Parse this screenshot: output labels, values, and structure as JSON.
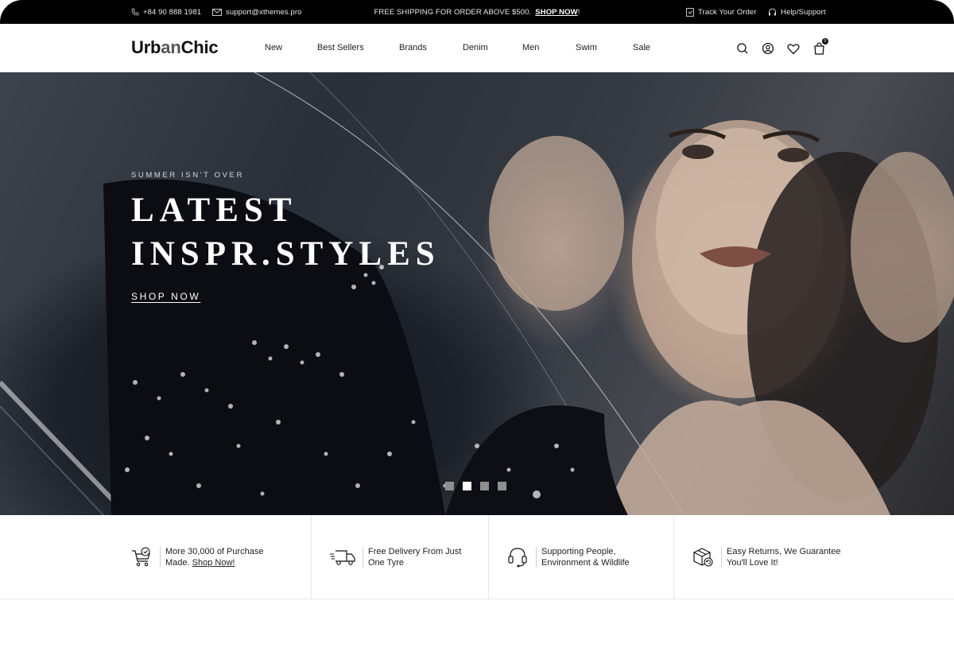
{
  "topbar": {
    "phone": "+84 90 888 1981",
    "email": "support@xthemes.pro",
    "promo_text": "FREE SHIPPING FOR ORDER ABOVE $500.",
    "promo_link": "SHOP NOW",
    "promo_suffix": "!",
    "track_order": "Track Your Order",
    "help": "Help/Support"
  },
  "header": {
    "logo_part1": "Urb",
    "logo_part2": "an",
    "logo_part3": "Chic",
    "nav": [
      "New",
      "Best Sellers",
      "Brands",
      "Denim",
      "Men",
      "Swim",
      "Sale"
    ],
    "icons": [
      "search-icon",
      "account-icon",
      "heart-icon",
      "bag-icon"
    ],
    "cart_count": "0"
  },
  "hero": {
    "subtitle": "SUMMER ISN'T OVER",
    "title_line1": "LATEST",
    "title_line2": "INSPR.STYLES",
    "cta": "SHOP NOW",
    "slides": 4,
    "active_slide": 2
  },
  "features": [
    {
      "icon": "cart-check-icon",
      "line1": "More 30,000 of Purchase",
      "line2_pre": "Made. ",
      "line2_link": "Shop Now!"
    },
    {
      "icon": "delivery-truck-icon",
      "line1": "Free Delivery From Just",
      "line2": "One Tyre"
    },
    {
      "icon": "headset-icon",
      "line1": "Supporting People,",
      "line2": "Environment & Wildlife"
    },
    {
      "icon": "return-box-icon",
      "line1": "Easy Returns, We Guarantee",
      "line2": "You'll Love It!"
    }
  ],
  "colors": {
    "topbar_bg": "#000000",
    "accent": "#111111",
    "page_bg": "#ffffff"
  }
}
